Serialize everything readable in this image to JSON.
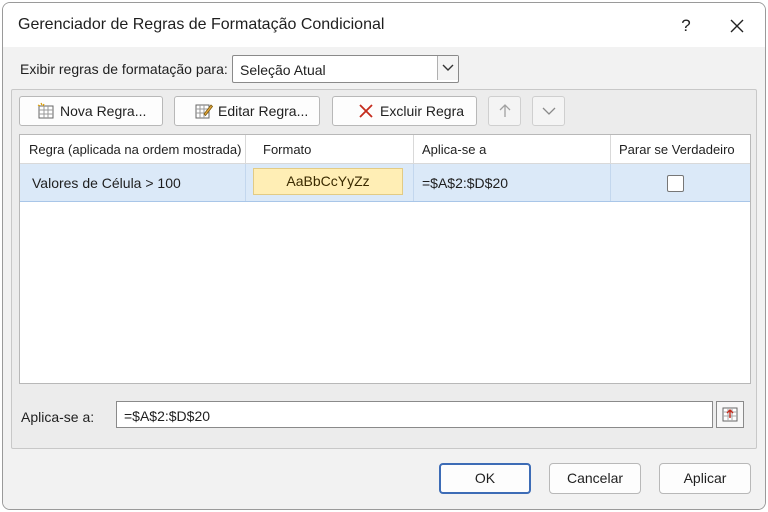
{
  "window": {
    "title": "Gerenciador de Regras de Formatação Condicional",
    "help_glyph": "?",
    "close_icon": "close-icon"
  },
  "show_rules": {
    "label": "Exibir regras de formatação para:",
    "selected": "Seleção Atual"
  },
  "toolbar": {
    "new_label": "Nova Regra...",
    "edit_label": "Editar Regra...",
    "delete_label": "Excluir Regra",
    "move_up_icon": "arrow-up-icon",
    "move_down_icon": "chevron-down-icon"
  },
  "rules_table": {
    "columns": [
      "Regra (aplicada na ordem mostrada)",
      "Formato",
      "Aplica-se a",
      "Parar se Verdadeiro"
    ],
    "rows": [
      {
        "rule": "Valores de Célula > 100",
        "format_preview": "AaBbCcYyZz",
        "applies_to": "=$A$2:$D$20",
        "stop_if_true": false
      }
    ]
  },
  "applies_to": {
    "label": "Aplica-se a:",
    "value": "=$A$2:$D$20"
  },
  "footer": {
    "ok_label": "OK",
    "cancel_label": "Cancelar",
    "apply_label": "Aplicar"
  },
  "colors": {
    "selected_row": "#dbe9f8",
    "format_fill": "#ffeeb5",
    "default_button_border": "#3d6cb6"
  }
}
